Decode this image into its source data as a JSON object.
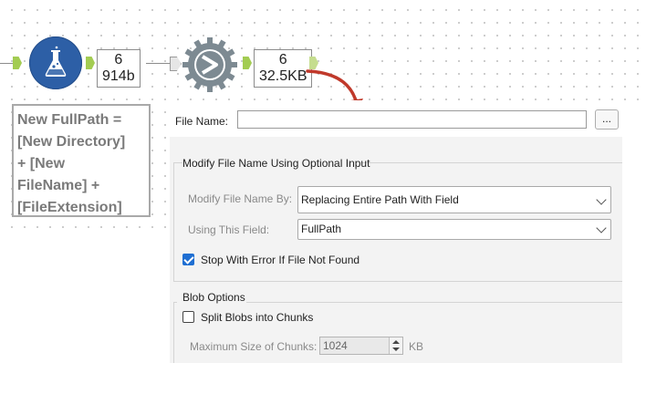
{
  "workflow": {
    "formula_tool": {
      "icon": "flask-icon",
      "color": "#2d5fa6"
    },
    "output_tool": {
      "icon": "output-gear-icon"
    },
    "formula_output_count": {
      "records": "6",
      "size": "914b"
    },
    "output_count": {
      "records": "6",
      "size": "32.5KB"
    },
    "annotation": "New FullPath =\n[New Directory]\n+ [New\nFileName] +\n[FileExtension]",
    "arrow_color": "#c0392b"
  },
  "config": {
    "file_name_label": "File Name:",
    "file_name_value": "",
    "browse_label": "...",
    "modify_group_title": "Modify File Name Using Optional Input",
    "modify_by_label": "Modify File Name By:",
    "modify_by_value": "Replacing Entire Path With Field",
    "using_field_label": "Using This Field:",
    "using_field_value": "FullPath",
    "stop_error_label": "Stop With Error If File Not Found",
    "stop_error_checked": true,
    "blob_group_title": "Blob Options",
    "split_blobs_label": "Split Blobs into Chunks",
    "split_blobs_checked": false,
    "max_chunk_label": "Maximum Size of Chunks:",
    "max_chunk_value": "1024",
    "max_chunk_unit": "KB"
  }
}
